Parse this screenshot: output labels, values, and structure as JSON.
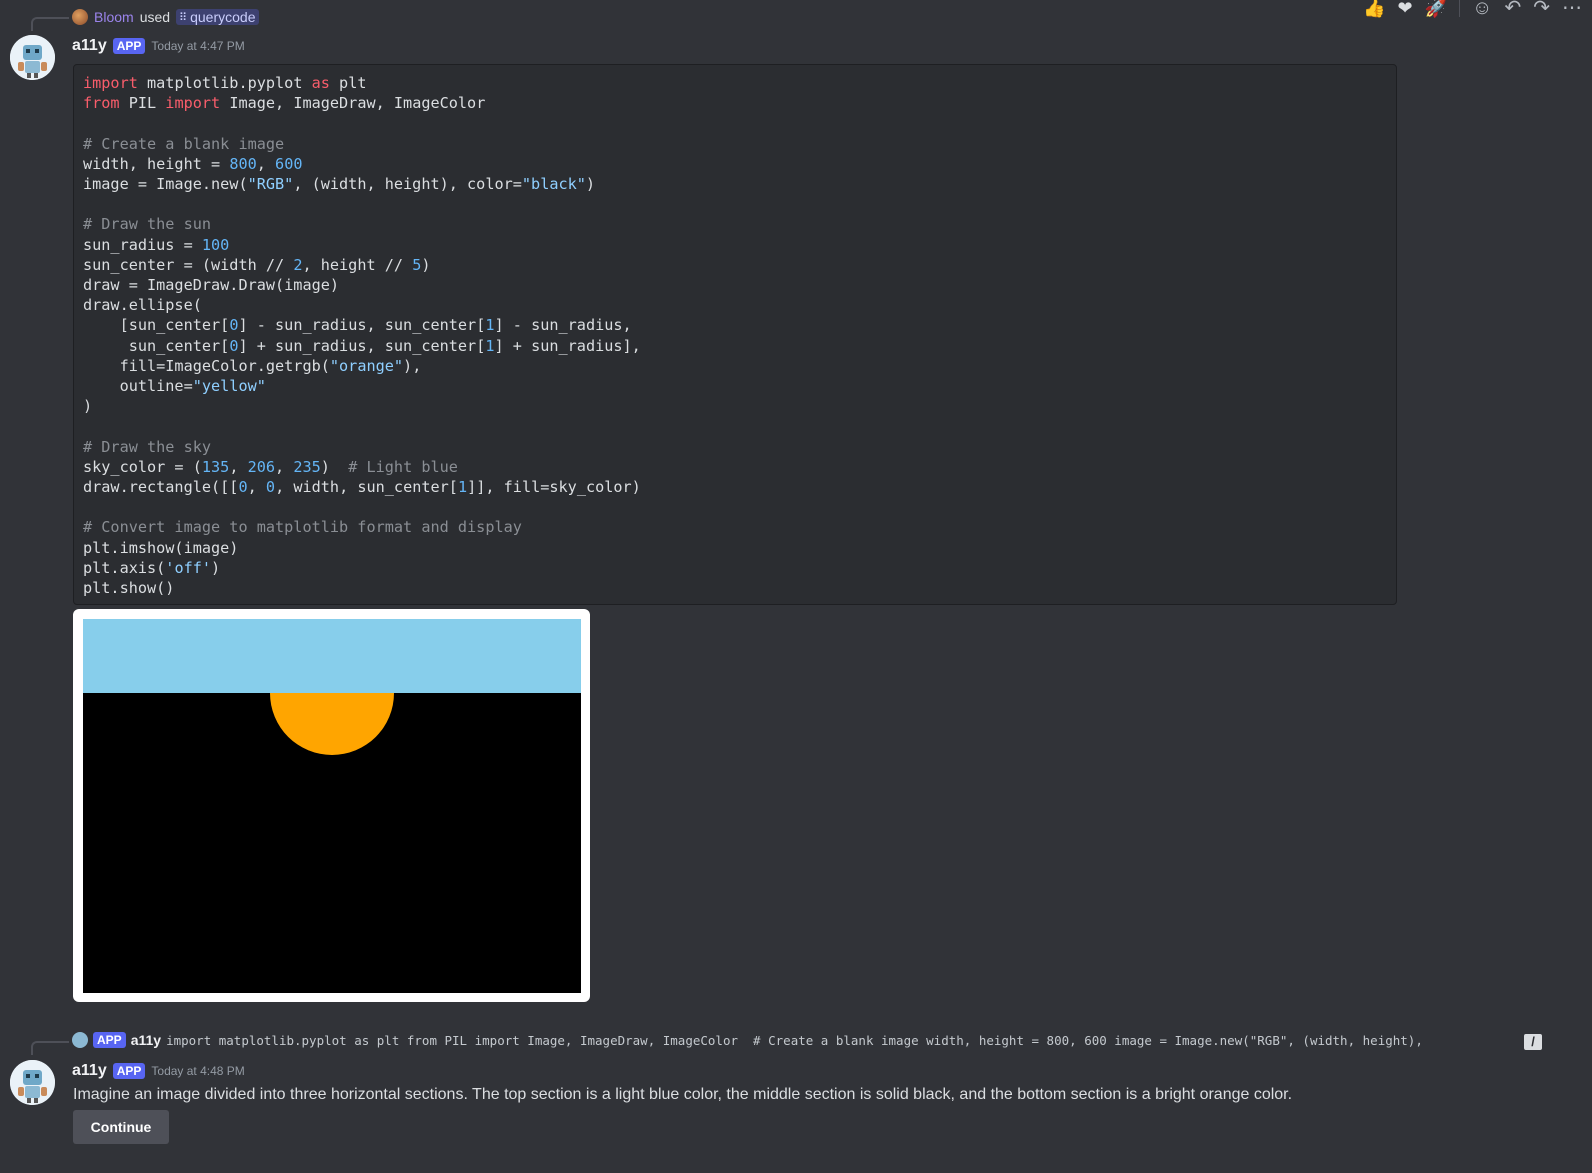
{
  "top_reply": {
    "user": "Bloom",
    "action": "used",
    "command": "querycode",
    "command_icon": "slash-command-icon"
  },
  "reactions": [
    {
      "emoji": "👍",
      "name": "thumbs-up-icon"
    },
    {
      "emoji": "❤",
      "name": "heart-icon"
    },
    {
      "emoji": "🚀",
      "name": "rocket-icon"
    }
  ],
  "hover_actions": [
    {
      "glyph": "☺",
      "name": "add-reaction-icon"
    },
    {
      "glyph": "↶",
      "name": "reply-icon"
    },
    {
      "glyph": "↷",
      "name": "forward-icon"
    },
    {
      "glyph": "⋯",
      "name": "more-icon"
    }
  ],
  "message1": {
    "username": "a11y",
    "badge": "APP",
    "timestamp": "Today at 4:47 PM",
    "code_lines": [
      [
        {
          "t": "k",
          "v": "import"
        },
        {
          "t": "p",
          "v": " matplotlib.pyplot "
        },
        {
          "t": "k",
          "v": "as"
        },
        {
          "t": "p",
          "v": " plt"
        }
      ],
      [
        {
          "t": "k",
          "v": "from"
        },
        {
          "t": "p",
          "v": " PIL "
        },
        {
          "t": "k",
          "v": "import"
        },
        {
          "t": "p",
          "v": " Image, ImageDraw, ImageColor"
        }
      ],
      [],
      [
        {
          "t": "c",
          "v": "# Create a blank image"
        }
      ],
      [
        {
          "t": "p",
          "v": "width, height = "
        },
        {
          "t": "n",
          "v": "800"
        },
        {
          "t": "p",
          "v": ", "
        },
        {
          "t": "n",
          "v": "600"
        }
      ],
      [
        {
          "t": "p",
          "v": "image = Image.new("
        },
        {
          "t": "s",
          "v": "\"RGB\""
        },
        {
          "t": "p",
          "v": ", (width, height), color="
        },
        {
          "t": "s",
          "v": "\"black\""
        },
        {
          "t": "p",
          "v": ")"
        }
      ],
      [],
      [
        {
          "t": "c",
          "v": "# Draw the sun"
        }
      ],
      [
        {
          "t": "p",
          "v": "sun_radius = "
        },
        {
          "t": "n",
          "v": "100"
        }
      ],
      [
        {
          "t": "p",
          "v": "sun_center = (width // "
        },
        {
          "t": "n",
          "v": "2"
        },
        {
          "t": "p",
          "v": ", height // "
        },
        {
          "t": "n",
          "v": "5"
        },
        {
          "t": "p",
          "v": ")"
        }
      ],
      [
        {
          "t": "p",
          "v": "draw = ImageDraw.Draw(image)"
        }
      ],
      [
        {
          "t": "p",
          "v": "draw.ellipse("
        }
      ],
      [
        {
          "t": "p",
          "v": "    [sun_center["
        },
        {
          "t": "n",
          "v": "0"
        },
        {
          "t": "p",
          "v": "] - sun_radius, sun_center["
        },
        {
          "t": "n",
          "v": "1"
        },
        {
          "t": "p",
          "v": "] - sun_radius,"
        }
      ],
      [
        {
          "t": "p",
          "v": "     sun_center["
        },
        {
          "t": "n",
          "v": "0"
        },
        {
          "t": "p",
          "v": "] + sun_radius, sun_center["
        },
        {
          "t": "n",
          "v": "1"
        },
        {
          "t": "p",
          "v": "] + sun_radius],"
        }
      ],
      [
        {
          "t": "p",
          "v": "    fill=ImageColor.getrgb("
        },
        {
          "t": "s",
          "v": "\"orange\""
        },
        {
          "t": "p",
          "v": "),"
        }
      ],
      [
        {
          "t": "p",
          "v": "    outline="
        },
        {
          "t": "s",
          "v": "\"yellow\""
        }
      ],
      [
        {
          "t": "p",
          "v": ")"
        }
      ],
      [],
      [
        {
          "t": "c",
          "v": "# Draw the sky"
        }
      ],
      [
        {
          "t": "p",
          "v": "sky_color = ("
        },
        {
          "t": "n",
          "v": "135"
        },
        {
          "t": "p",
          "v": ", "
        },
        {
          "t": "n",
          "v": "206"
        },
        {
          "t": "p",
          "v": ", "
        },
        {
          "t": "n",
          "v": "235"
        },
        {
          "t": "p",
          "v": ")  "
        },
        {
          "t": "c",
          "v": "# Light blue"
        }
      ],
      [
        {
          "t": "p",
          "v": "draw.rectangle([["
        },
        {
          "t": "n",
          "v": "0"
        },
        {
          "t": "p",
          "v": ", "
        },
        {
          "t": "n",
          "v": "0"
        },
        {
          "t": "p",
          "v": ", width, sun_center["
        },
        {
          "t": "n",
          "v": "1"
        },
        {
          "t": "p",
          "v": "]], fill=sky_color)"
        }
      ],
      [],
      [
        {
          "t": "c",
          "v": "# Convert image to matplotlib format and display"
        }
      ],
      [
        {
          "t": "p",
          "v": "plt.imshow(image)"
        }
      ],
      [
        {
          "t": "p",
          "v": "plt.axis("
        },
        {
          "t": "s",
          "v": "'off'"
        },
        {
          "t": "p",
          "v": ")"
        }
      ],
      [
        {
          "t": "p",
          "v": "plt.show()"
        }
      ]
    ],
    "image": {
      "sky_color": "#87ceeb",
      "background_color": "#000000",
      "sun_color": "#ffa500"
    }
  },
  "reply_preview": {
    "badge": "APP",
    "username": "a11y",
    "snippet": "import matplotlib.pyplot as plt from PIL import Image, ImageDraw, ImageColor  # Create a blank image width, height = 800, 600 image = Image.new(\"RGB\", (width, height),"
  },
  "message2": {
    "username": "a11y",
    "badge": "APP",
    "timestamp": "Today at 4:48 PM",
    "text": "Imagine an image divided into three horizontal sections. The top section is a light blue color, the middle section is solid black, and the bottom section is a bright orange color.",
    "button_label": "Continue"
  }
}
